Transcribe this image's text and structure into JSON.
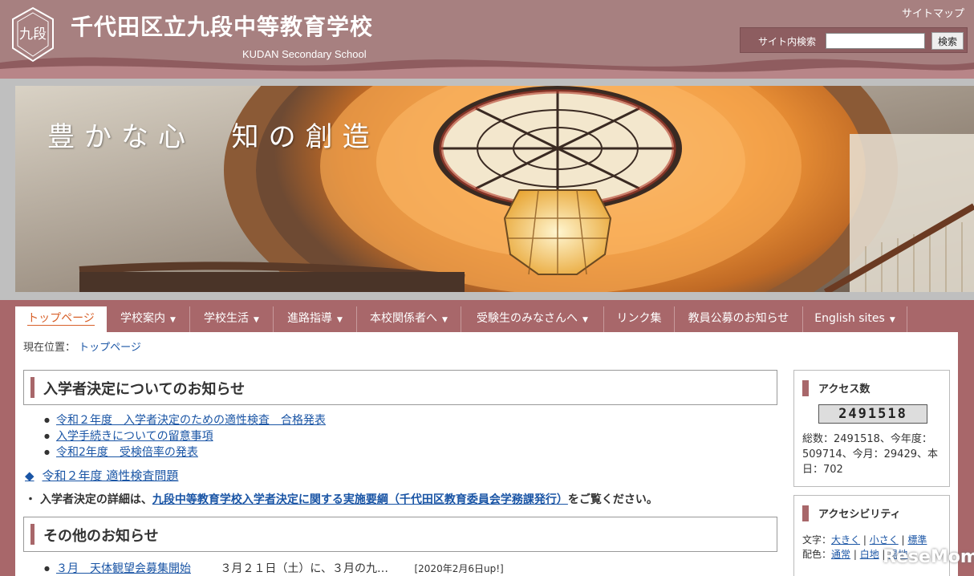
{
  "header": {
    "title": "千代田区立九段中等教育学校",
    "subtitle": "KUDAN Secondary School",
    "emblem_text": "九段",
    "sitemap": "サイトマップ",
    "search_label": "サイト内検索",
    "search_value": "",
    "search_button": "検索"
  },
  "hero": {
    "slogan": "豊かな心  知の創造"
  },
  "nav": [
    {
      "label": "トップページ",
      "dropdown": false,
      "active": true
    },
    {
      "label": "学校案内",
      "dropdown": true
    },
    {
      "label": "学校生活",
      "dropdown": true
    },
    {
      "label": "進路指導",
      "dropdown": true
    },
    {
      "label": "本校関係者へ",
      "dropdown": true
    },
    {
      "label": "受験生のみなさんへ",
      "dropdown": true
    },
    {
      "label": "リンク集",
      "dropdown": false
    },
    {
      "label": "教員公募のお知らせ",
      "dropdown": false
    },
    {
      "label": "English sites",
      "dropdown": true
    }
  ],
  "breadcrumb": {
    "label": "現在位置：",
    "current": "トップページ"
  },
  "main": {
    "section1_title": "入学者決定についてのお知らせ",
    "notices": [
      "令和２年度　入学者決定のための適性検査　合格発表",
      "入学手続きについての留意事項",
      "令和2年度　受検倍率の発表"
    ],
    "exam_link": "令和２年度 適性検査問題",
    "detail_prefix": "・ 入学者決定の詳細は、",
    "detail_link": "九段中等教育学校入学者決定に関する実施要綱（千代田区教育委員会学務課発行）",
    "detail_suffix": "をご覧ください。",
    "section2_title": "その他のお知らせ",
    "other_link": "３月　天体観望会募集開始",
    "other_text": "３月２１日（土）に、３月の九…",
    "other_date": "[2020年2月6日up!]"
  },
  "sidebar": {
    "access_title": "アクセス数",
    "counter": "2491518",
    "access_stats": "総数：2491518、今年度：509714、今月：29429、本日：702",
    "a11y_title": "アクセシビリティ",
    "text_label": "文字：",
    "text_large": "大きく",
    "text_small": "小さく",
    "text_normal": "標準",
    "color_label": "配色：",
    "color_normal": "通常",
    "color_white": "白地",
    "color_black": "黒地",
    "sep": " | "
  },
  "watermark": "ReseMom",
  "colors": {
    "brand": "#a8676a",
    "link": "#1a55a5",
    "active_tab": "#d8602a"
  }
}
